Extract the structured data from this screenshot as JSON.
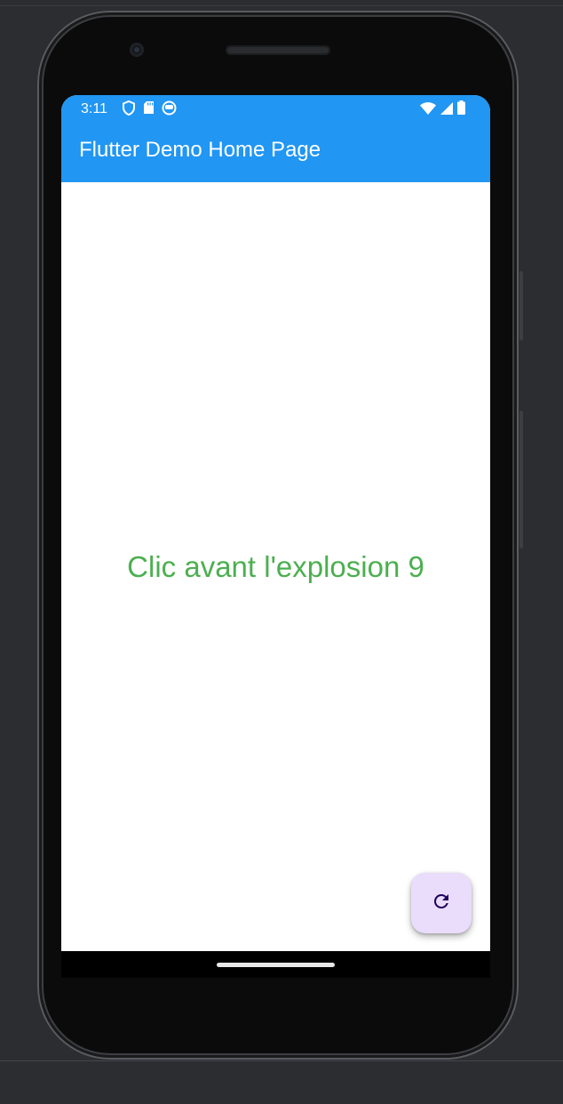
{
  "status_bar": {
    "time": "3:11",
    "left_icons": [
      "shield-icon",
      "sd-card-icon",
      "app-notification-icon"
    ],
    "right_icons": [
      "wifi-icon",
      "cell-signal-icon",
      "battery-icon"
    ]
  },
  "app_bar": {
    "title": "Flutter Demo Home Page",
    "color": "#2196f3"
  },
  "body": {
    "message": "Clic avant l'explosion 9",
    "message_color": "#4caf50"
  },
  "fab": {
    "icon": "refresh-icon",
    "background": "#eadcfb"
  }
}
